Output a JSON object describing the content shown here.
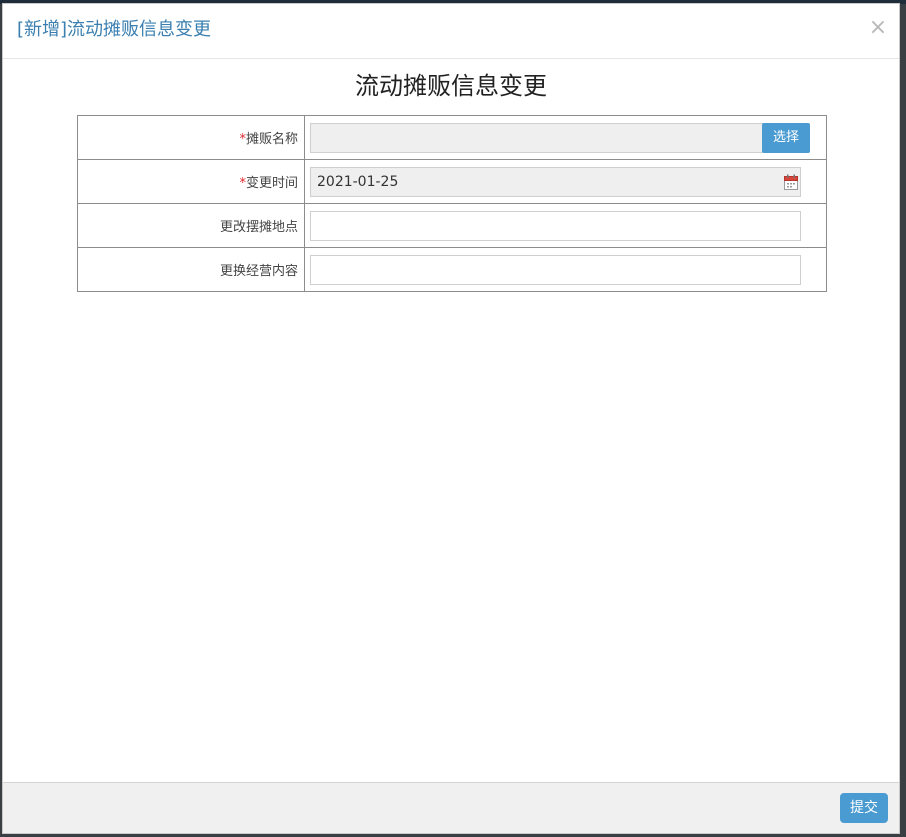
{
  "dialog": {
    "title": "[新增]流动摊贩信息变更",
    "close_label": "×"
  },
  "form": {
    "title": "流动摊贩信息变更",
    "required_mark": "*",
    "rows": [
      {
        "label": "摊贩名称",
        "required": true,
        "value": "",
        "button_label": "选择"
      },
      {
        "label": "变更时间",
        "required": true,
        "value": "2021-01-25"
      },
      {
        "label": "更改摆摊地点",
        "required": false,
        "value": ""
      },
      {
        "label": "更换经营内容",
        "required": false,
        "value": ""
      }
    ]
  },
  "footer": {
    "submit_label": "提交"
  },
  "colors": {
    "accent": "#4a9bd1",
    "title": "#3a7fb0",
    "required": "#e0262b"
  }
}
